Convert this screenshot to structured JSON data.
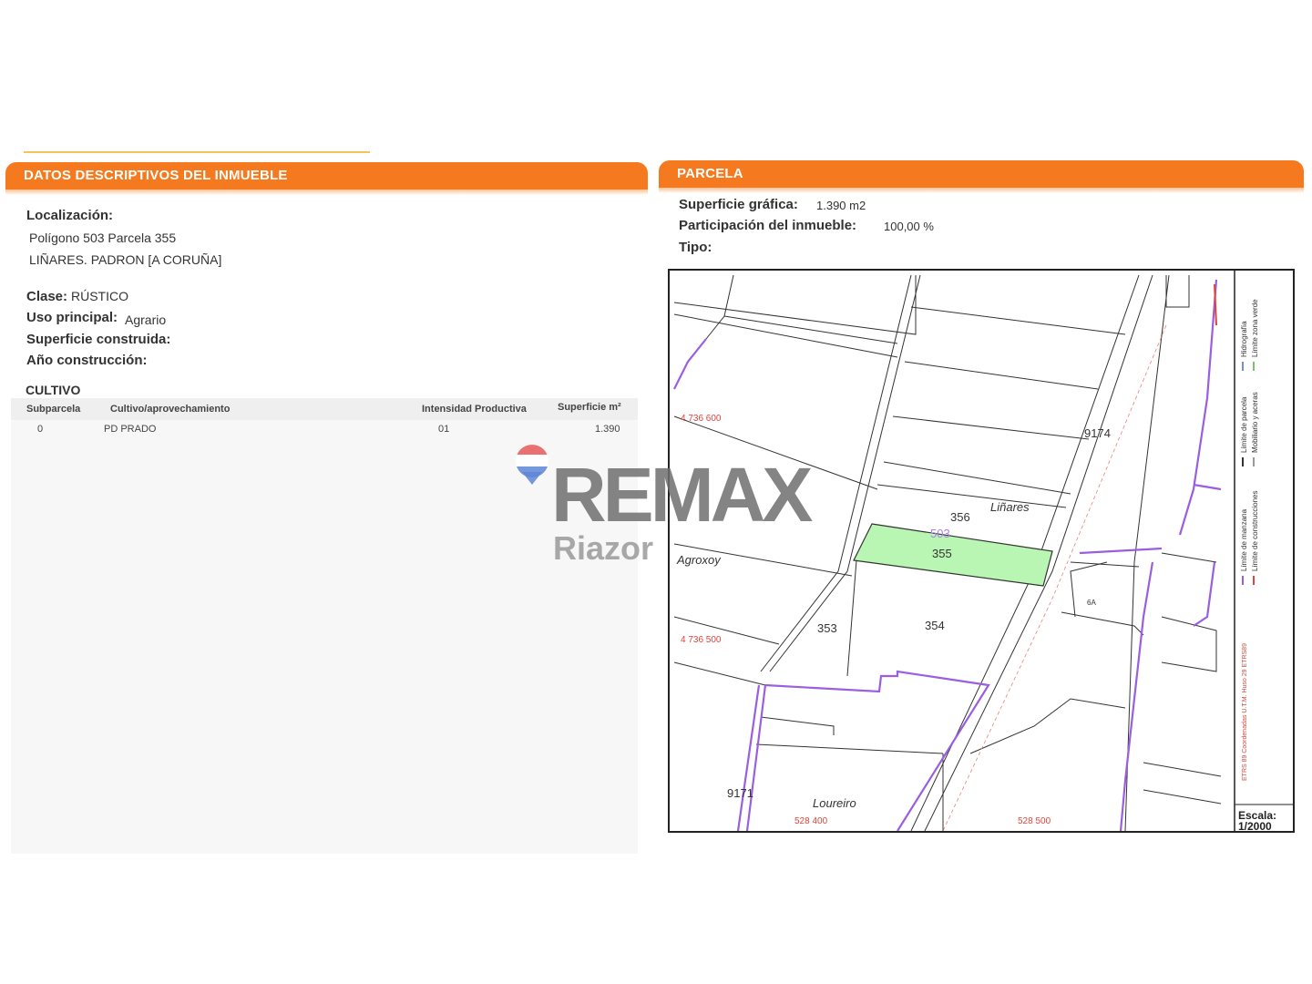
{
  "left_panel": {
    "title": "DATOS DESCRIPTIVOS DEL INMUEBLE",
    "localizacion_label": "Localización:",
    "localizacion_line1": "Polígono 503 Parcela 355",
    "localizacion_line2": "LIÑARES. PADRON [A CORUÑA]",
    "clase_label": "Clase:",
    "clase_value": "RÚSTICO",
    "uso_label": "Uso principal:",
    "uso_value": "Agrario",
    "superficie_construida_label": "Superficie construida:",
    "ano_label": "Año construcción:",
    "cultivo_title": "CULTIVO",
    "table": {
      "headers": [
        "Subparcela",
        "Cultivo/aprovechamiento",
        "Intensidad Productiva",
        "Superficie m²"
      ],
      "rows": [
        [
          "0",
          "PD PRADO",
          "01",
          "1.390"
        ]
      ]
    }
  },
  "right_panel": {
    "title": "PARCELA",
    "superficie_label": "Superficie gráfica:",
    "superficie_value": "1.390 m2",
    "participacion_label": "Participación del inmueble:",
    "participacion_value": "100,00 %",
    "tipo_label": "Tipo:"
  },
  "map": {
    "parcel_labels": [
      "356",
      "355",
      "354",
      "353",
      "9174",
      "9171",
      "6A"
    ],
    "polygon_label": "503",
    "place_names": [
      "Liñares",
      "Agroxoy",
      "Loureiro"
    ],
    "coordinates": [
      "4 736 600",
      "4 736 500",
      "528 400",
      "528 500"
    ],
    "legend": [
      "Límite de manzana",
      "Límite de parcela",
      "Límite de construcciones",
      "Mobiliario y aceras",
      "Límite zona verde",
      "Hidrografía"
    ],
    "legend_crs": "ETRS 89 Coordenadas U.T.M. Huso 29 ETRS89",
    "scale_label": "Escala:",
    "scale_value": "1/2000",
    "colors": {
      "highlight": "#b9f5b3",
      "boundary": "#9a5ee0",
      "coords": "#e0443a"
    }
  },
  "watermark": {
    "brand": "REMAX",
    "office": "Riazor"
  }
}
